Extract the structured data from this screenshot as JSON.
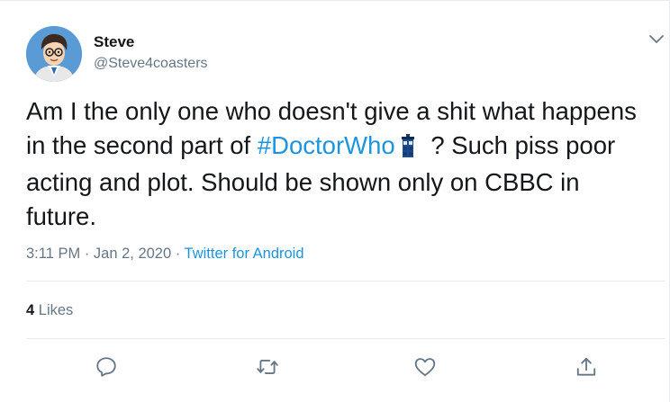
{
  "user": {
    "name": "Steve",
    "handle": "@Steve4coasters"
  },
  "tweet": {
    "text_before": "Am I the only one who doesn't give a shit what happens in the second part of ",
    "hashtag": "#DoctorWho",
    "text_after": " ? Such piss poor acting and plot. Should be shown only on CBBC in future.",
    "emoji": "tardis-icon"
  },
  "meta": {
    "time": "3:11 PM",
    "separator1": " · ",
    "date": "Jan 2, 2020",
    "separator2": " · ",
    "source": "Twitter for Android"
  },
  "stats": {
    "likes_count": "4",
    "likes_label": " Likes"
  },
  "actions": [
    "reply-icon",
    "retweet-icon",
    "like-icon",
    "share-icon"
  ],
  "colors": {
    "accent": "#1b95e0",
    "text": "#14171a",
    "secondary": "#657786",
    "border": "#e6ecf0"
  }
}
